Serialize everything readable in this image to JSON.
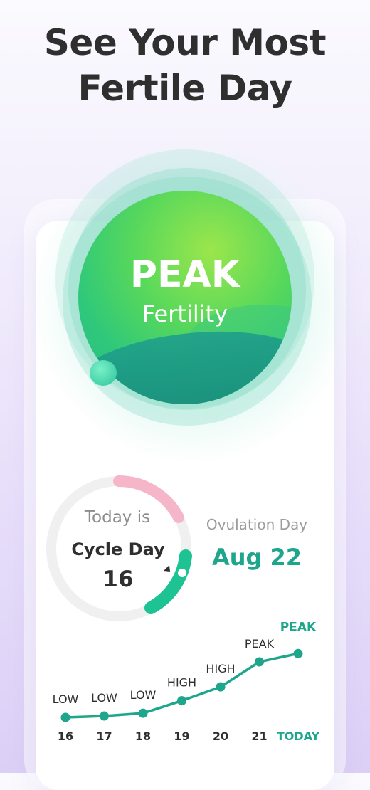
{
  "headline": {
    "line1": "See Your Most",
    "line2": "Fertile Day"
  },
  "status_circle": {
    "level": "PEAK",
    "label": "Fertility"
  },
  "cycle": {
    "today_label": "Today is",
    "cycle_day_label": "Cycle Day",
    "day": "16"
  },
  "ovulation": {
    "label": "Ovulation Day",
    "date": "Aug 22"
  },
  "colors": {
    "accent": "#1ea68c",
    "peak_green": "#58d85b",
    "period_pink": "#f6b6c9",
    "track": "#f0f0f0",
    "text": "#2f2f2f"
  },
  "chart_data": {
    "type": "line",
    "x": [
      "16",
      "17",
      "18",
      "19",
      "20",
      "21",
      "TODAY"
    ],
    "levels": [
      "LOW",
      "LOW",
      "LOW",
      "HIGH",
      "HIGH",
      "PEAK",
      "PEAK"
    ],
    "values": [
      1,
      1.05,
      1.15,
      1.6,
      2.1,
      3.0,
      3.3
    ],
    "title": "",
    "xlabel": "",
    "ylabel": ""
  }
}
